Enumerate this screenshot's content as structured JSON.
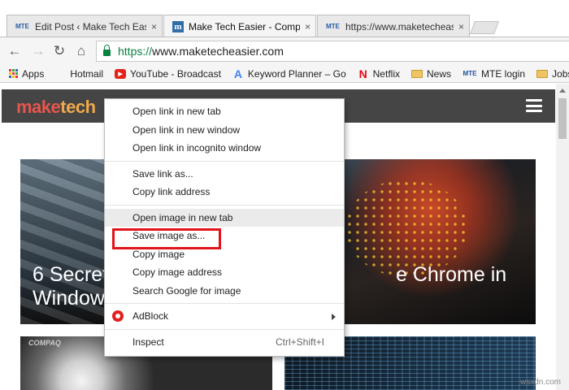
{
  "tabs": [
    {
      "favicon": "MTE",
      "title": "Edit Post ‹ Make Tech Eas",
      "close": "×"
    },
    {
      "favicon": "m",
      "title": "Make Tech Easier - Comp",
      "close": "×"
    },
    {
      "favicon": "MTE",
      "title": "https://www.maketecheas",
      "close": "×"
    }
  ],
  "nav": {
    "back": "←",
    "forward": "→",
    "reload": "↻",
    "home": "⌂"
  },
  "omnibox": {
    "scheme": "https://",
    "url": "www.maketecheasier.com"
  },
  "bookmarks": [
    {
      "label": "Apps",
      "icon": "apps-grid-icon"
    },
    {
      "label": "Hotmail",
      "icon": "microsoft-logo-icon"
    },
    {
      "label": "YouTube - Broadcast",
      "icon": "youtube-icon"
    },
    {
      "label": "Keyword Planner – Go",
      "icon": "google-ads-icon"
    },
    {
      "label": "Netflix",
      "icon": "netflix-icon"
    },
    {
      "label": "News",
      "icon": "folder-icon"
    },
    {
      "label": "MTE login",
      "icon": "mte-icon"
    },
    {
      "label": "Jobs",
      "icon": "folder-icon"
    }
  ],
  "site": {
    "logo_a": "make",
    "logo_b": "tech",
    "hero_title_line1_left": "6 Secret",
    "hero_title_line1_right": "e Chrome in",
    "hero_title_line2": "Window",
    "thumb_brand": "COMPAQ"
  },
  "context_menu": {
    "items": [
      {
        "label": "Open link in new tab"
      },
      {
        "label": "Open link in new window"
      },
      {
        "label": "Open link in incognito window"
      },
      {
        "label": "Save link as..."
      },
      {
        "label": "Copy link address"
      },
      {
        "label": "Open image in new tab"
      },
      {
        "label": "Save image as..."
      },
      {
        "label": "Copy image"
      },
      {
        "label": "Copy image address"
      },
      {
        "label": "Search Google for image"
      },
      {
        "label": "AdBlock"
      },
      {
        "label": "Inspect",
        "shortcut": "Ctrl+Shift+I"
      }
    ]
  },
  "watermark": "wsxdn.com",
  "colors": {
    "highlight_box": "#e1141b",
    "logo_make": "#e5564d",
    "logo_tech": "#f0a94a",
    "header_bg": "#454545"
  }
}
